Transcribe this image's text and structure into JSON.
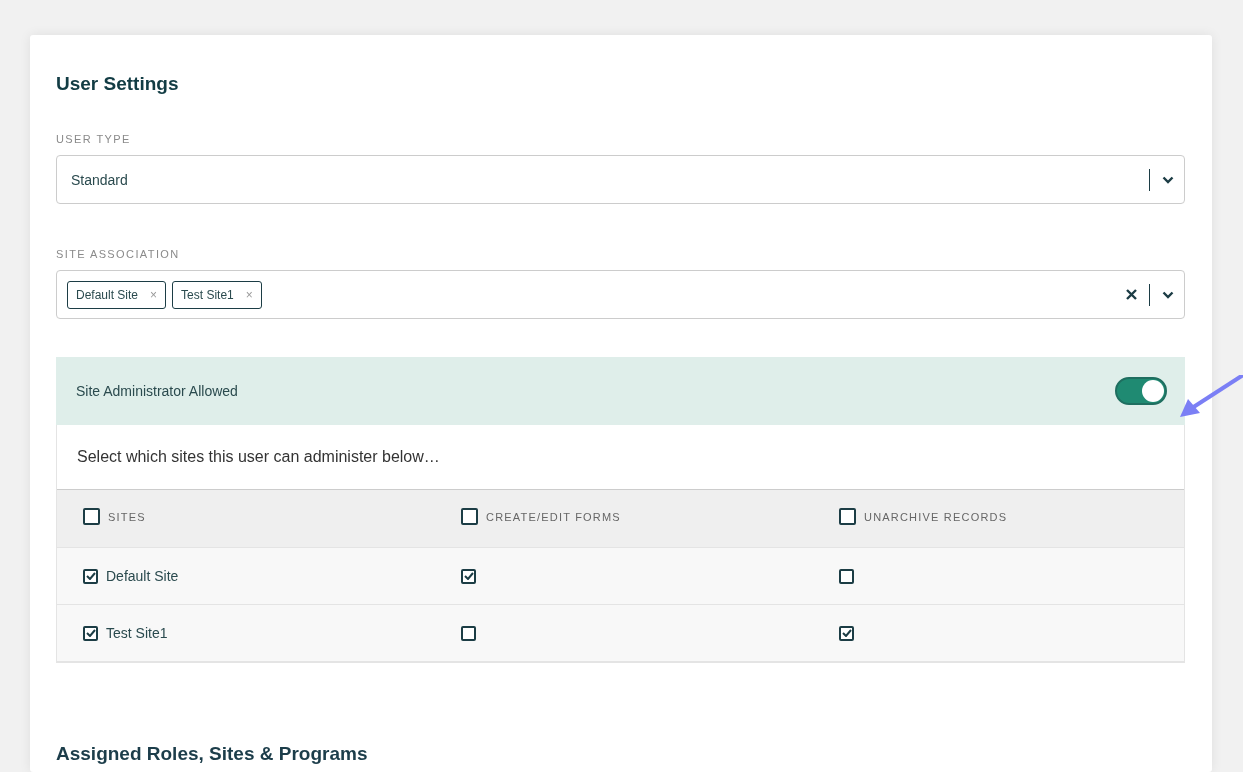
{
  "title": "User Settings",
  "user_type": {
    "label": "USER TYPE",
    "value": "Standard"
  },
  "site_association": {
    "label": "SITE ASSOCIATION",
    "tags": [
      {
        "label": "Default Site",
        "remove": "×"
      },
      {
        "label": "Test Site1",
        "remove": "×"
      }
    ]
  },
  "site_admin": {
    "label": "Site Administrator Allowed",
    "on": true,
    "hint": "Select which sites this user can administer below…"
  },
  "table": {
    "columns": [
      {
        "label": "SITES",
        "checked": false
      },
      {
        "label": "CREATE/EDIT FORMS",
        "checked": false
      },
      {
        "label": "UNARCHIVE RECORDS",
        "checked": false
      }
    ],
    "rows": [
      {
        "site": "Default Site",
        "checked": true,
        "create_edit": true,
        "unarchive": false
      },
      {
        "site": "Test Site1",
        "checked": true,
        "create_edit": false,
        "unarchive": true
      }
    ]
  },
  "section_title": "Assigned Roles, Sites & Programs"
}
